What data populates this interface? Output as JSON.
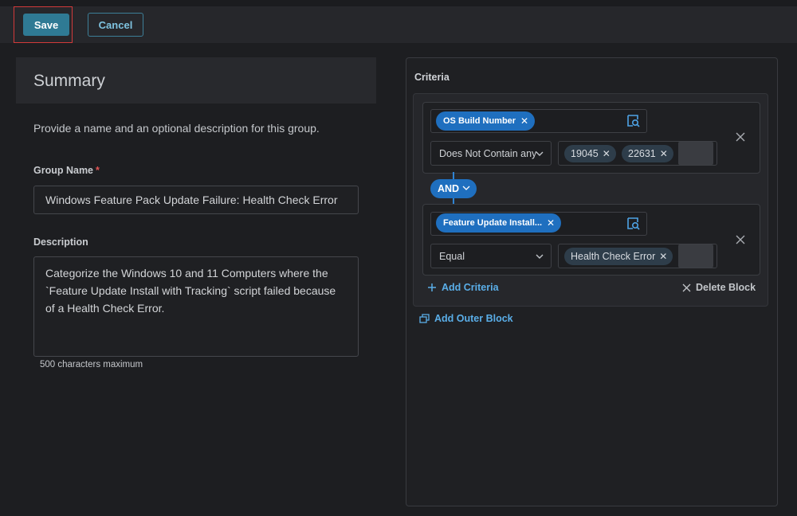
{
  "toolbar": {
    "save_label": "Save",
    "cancel_label": "Cancel"
  },
  "summary": {
    "title": "Summary",
    "description": "Provide a name and an optional description for this group.",
    "group_name_label": "Group Name",
    "required_marker": "*",
    "group_name_value": "Windows Feature Pack Update Failure: Health Check Error",
    "description_label": "Description",
    "description_value": "Categorize the Windows 10 and 11 Computers where the `Feature Update Install with Tracking` script failed because of a Health Check Error.",
    "description_hint": "500 characters maximum"
  },
  "criteria": {
    "title": "Criteria",
    "rules": [
      {
        "field": "OS Build Number",
        "operator": "Does Not Contain any",
        "values": [
          "19045",
          "22631"
        ]
      },
      {
        "field": "Feature Update Install...",
        "operator": "Equal",
        "values": [
          "Health Check Error"
        ]
      }
    ],
    "connector": "AND",
    "add_criteria_label": "Add Criteria",
    "delete_block_label": "Delete Block",
    "add_outer_block_label": "Add Outer Block"
  },
  "colors": {
    "accent": "#1f6fbf",
    "link": "#5aaee8",
    "save_button": "#2f7a94",
    "highlight_box": "#d23a3a"
  }
}
